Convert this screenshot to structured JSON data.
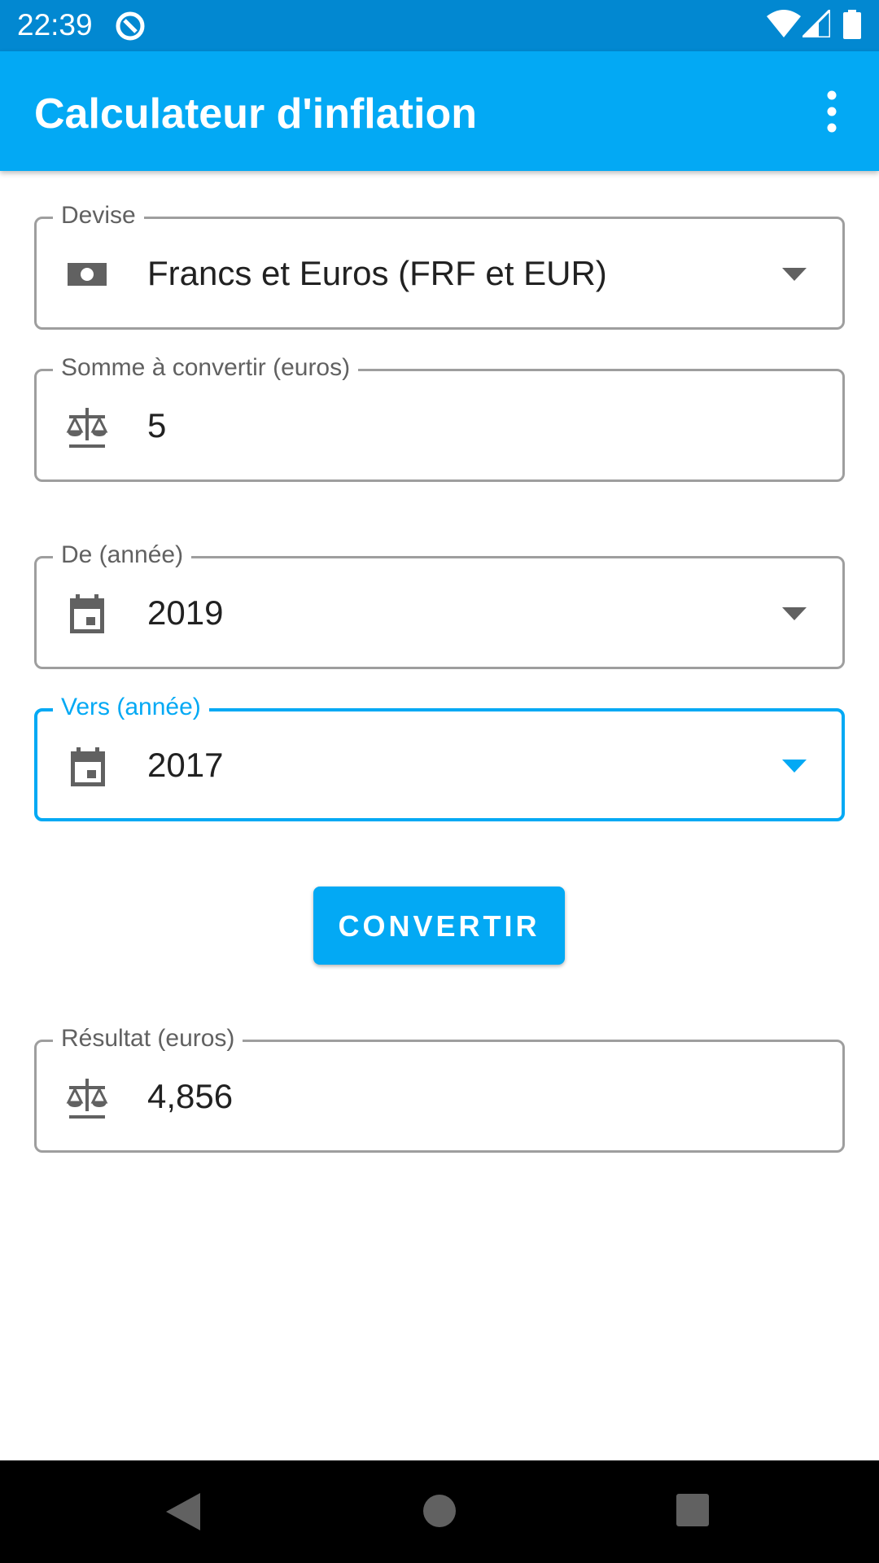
{
  "status_bar": {
    "time": "22:39"
  },
  "app_bar": {
    "title": "Calculateur d'inflation"
  },
  "form": {
    "currency": {
      "label": "Devise",
      "value": "Francs et Euros (FRF et EUR)",
      "icon": "banknote-icon"
    },
    "amount": {
      "label": "Somme à convertir (euros)",
      "value": "5",
      "icon": "scale-icon"
    },
    "from_year": {
      "label": "De (année)",
      "value": "2019",
      "icon": "calendar-icon"
    },
    "to_year": {
      "label": "Vers (année)",
      "value": "2017",
      "icon": "calendar-icon"
    },
    "convert_label": "CONVERTIR",
    "result": {
      "label": "Résultat (euros)",
      "value": "4,856",
      "icon": "scale-icon"
    }
  },
  "colors": {
    "primary": "#03a9f4",
    "primary_dark": "#0288d1",
    "outline": "#9e9e9e",
    "icon": "#616161"
  }
}
